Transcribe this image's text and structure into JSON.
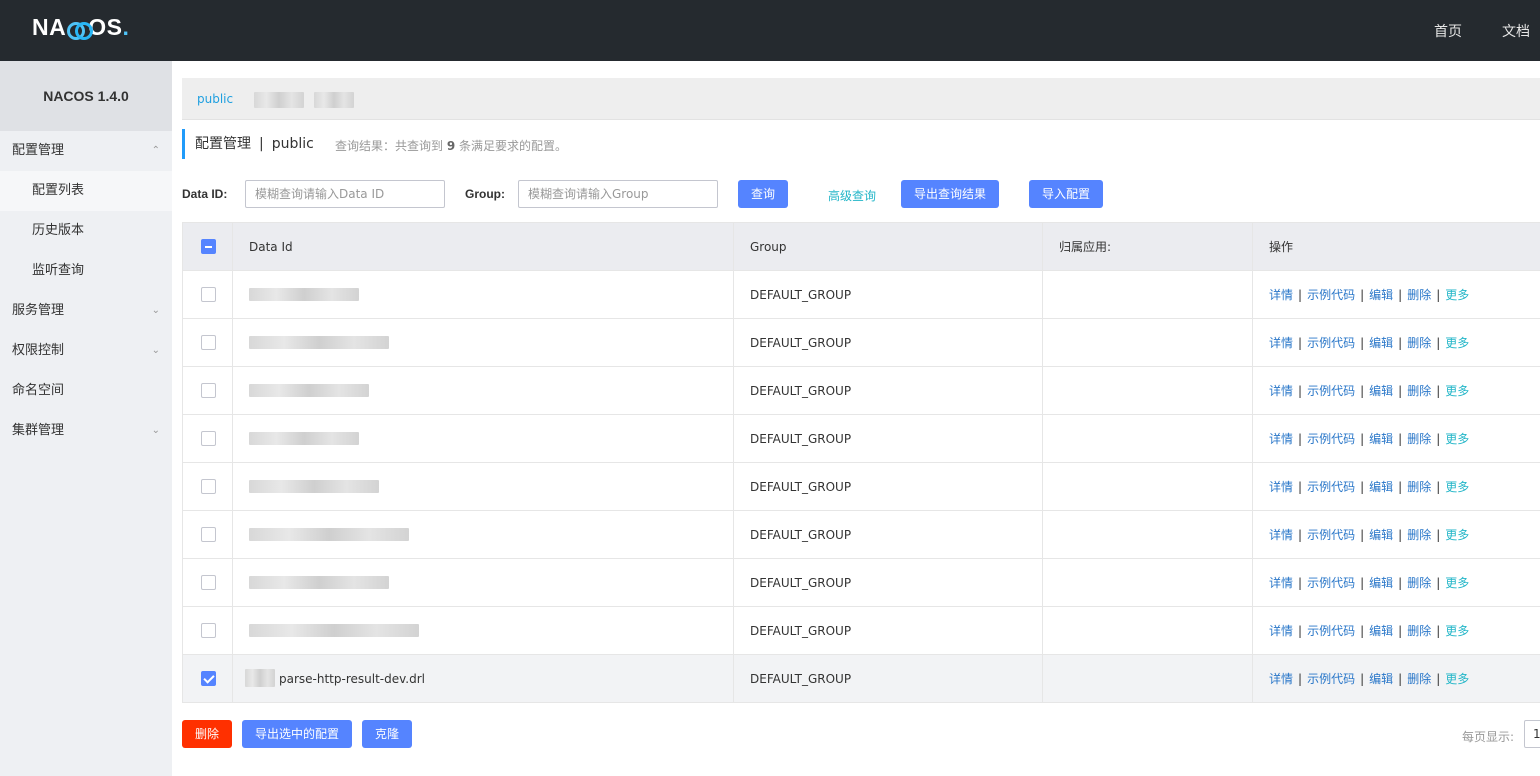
{
  "header": {
    "logo_text_a": "NA",
    "logo_text_b": "OS",
    "logo_dot": ".",
    "nav": [
      "首页",
      "文档"
    ]
  },
  "sidebar": {
    "title": "NACOS 1.4.0",
    "items": [
      {
        "label": "配置管理",
        "chevron": "^"
      },
      {
        "label": "配置列表"
      },
      {
        "label": "历史版本"
      },
      {
        "label": "监听查询"
      },
      {
        "label": "服务管理",
        "chevron": "v"
      },
      {
        "label": "权限控制",
        "chevron": "v"
      },
      {
        "label": "命名空间"
      },
      {
        "label": "集群管理",
        "chevron": "v"
      }
    ]
  },
  "namespace_bar": {
    "active": "public"
  },
  "page": {
    "title": "配置管理",
    "separator": "|",
    "namespace": "public",
    "result_prefix": "查询结果：共查询到",
    "result_count": "9",
    "result_suffix": "条满足要求的配置。"
  },
  "filters": {
    "dataid_label": "Data ID:",
    "dataid_placeholder": "模糊查询请输入Data ID",
    "group_label": "Group:",
    "group_placeholder": "模糊查询请输入Group",
    "query_btn": "查询",
    "advanced_link": "高级查询",
    "export_btn": "导出查询结果",
    "import_btn": "导入配置"
  },
  "table": {
    "columns": [
      "Data Id",
      "Group",
      "归属应用:",
      "操作"
    ],
    "rows": [
      {
        "data_id": "",
        "group": "DEFAULT_GROUP",
        "app": "",
        "checked": false
      },
      {
        "data_id": "",
        "group": "DEFAULT_GROUP",
        "app": "",
        "checked": false
      },
      {
        "data_id": "",
        "group": "DEFAULT_GROUP",
        "app": "",
        "checked": false
      },
      {
        "data_id": "",
        "group": "DEFAULT_GROUP",
        "app": "",
        "checked": false
      },
      {
        "data_id": "",
        "group": "DEFAULT_GROUP",
        "app": "",
        "checked": false
      },
      {
        "data_id": "",
        "group": "DEFAULT_GROUP",
        "app": "",
        "checked": false
      },
      {
        "data_id": "",
        "group": "DEFAULT_GROUP",
        "app": "",
        "checked": false
      },
      {
        "data_id": "",
        "group": "DEFAULT_GROUP",
        "app": "",
        "checked": false
      },
      {
        "data_id": "parse-http-result-dev.drl",
        "group": "DEFAULT_GROUP",
        "app": "",
        "checked": true
      }
    ],
    "ops": {
      "detail": "详情",
      "sample": "示例代码",
      "edit": "编辑",
      "delete": "删除",
      "more": "更多",
      "sep": "|"
    }
  },
  "bottom": {
    "delete_btn": "删除",
    "export_selected_btn": "导出选中的配置",
    "clone_btn": "克隆",
    "per_page_label": "每页显示:",
    "per_page_value": "1"
  }
}
